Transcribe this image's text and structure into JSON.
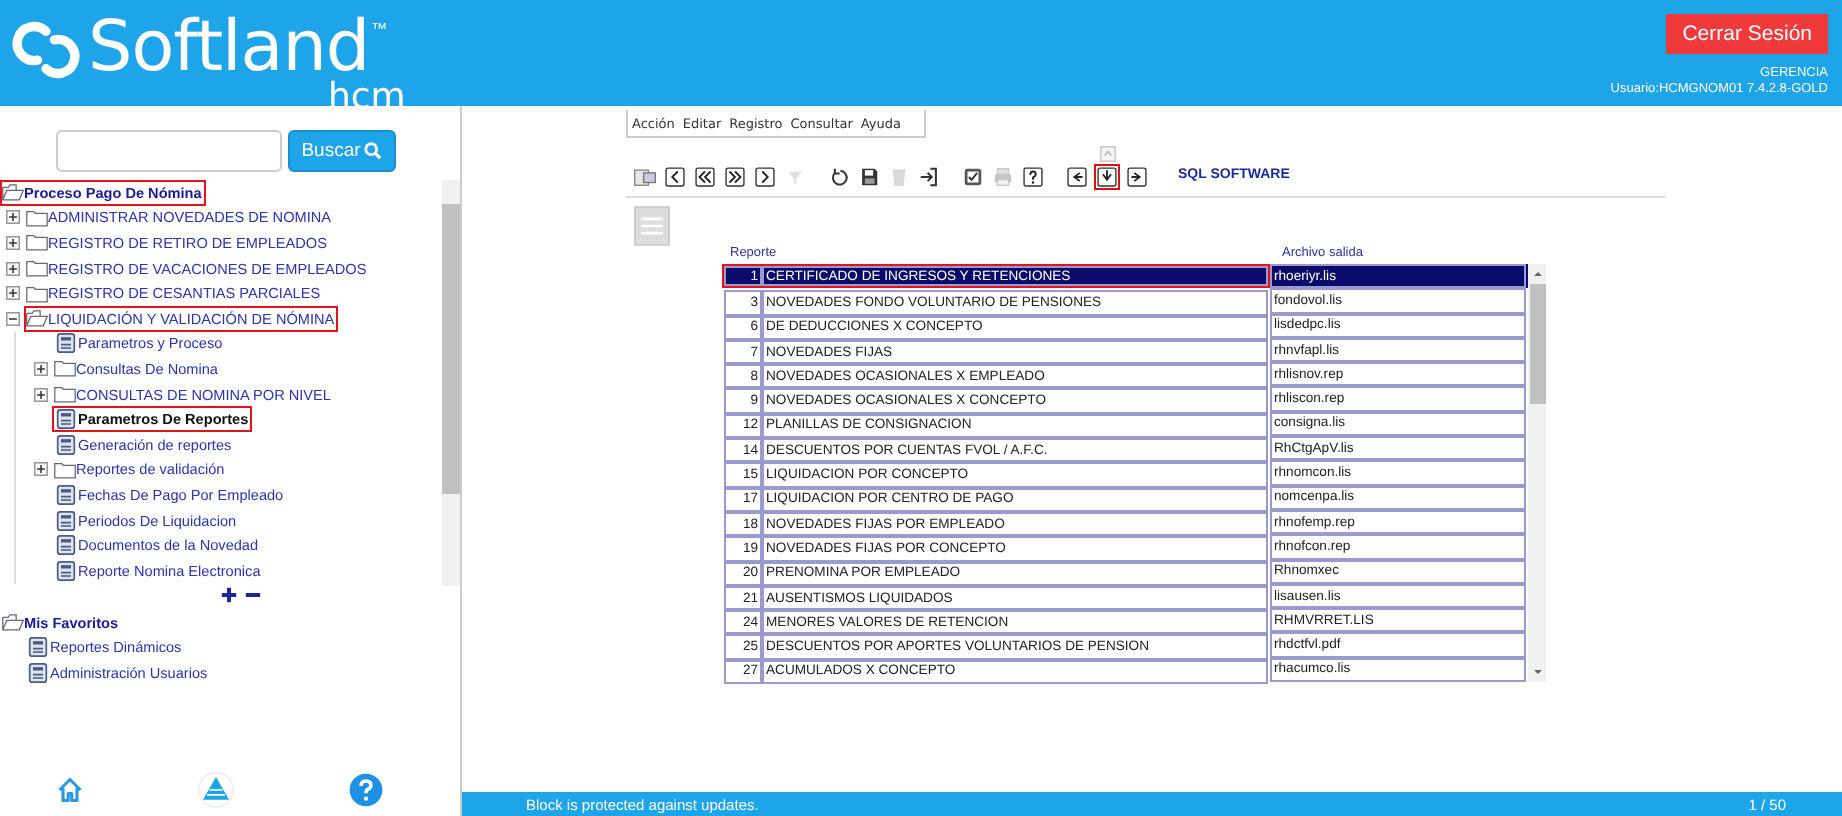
{
  "header": {
    "brand": "Softland",
    "trademark": "™",
    "product": "hcm",
    "logout_button": "Cerrar Sesión",
    "role": "GERENCIA",
    "user": "Usuario:HCMGNOM01 7.4.2.8-GOLD"
  },
  "sidebar": {
    "search_button": "Buscar",
    "tree": [
      {
        "label": "Proceso Pago De Nómina",
        "kind": "folder",
        "expanded": true,
        "highlighted": true,
        "selected": false,
        "children": [
          {
            "label": "ADMINISTRAR NOVEDADES DE NOMINA",
            "kind": "folder",
            "expanded": false,
            "highlighted": false,
            "selected": false
          },
          {
            "label": "REGISTRO DE RETIRO DE EMPLEADOS",
            "kind": "folder",
            "expanded": false,
            "highlighted": false,
            "selected": false
          },
          {
            "label": "REGISTRO DE VACACIONES DE EMPLEADOS",
            "kind": "folder",
            "expanded": false,
            "highlighted": false,
            "selected": false
          },
          {
            "label": "REGISTRO DE CESANTIAS PARCIALES",
            "kind": "folder",
            "expanded": false,
            "highlighted": false,
            "selected": false
          },
          {
            "label": "LIQUIDACIÓN Y VALIDACIÓN DE NÓMINA",
            "kind": "folder",
            "expanded": true,
            "highlighted": true,
            "selected": false,
            "children": [
              {
                "label": "Parametros y Proceso",
                "kind": "document",
                "highlighted": false,
                "selected": false
              },
              {
                "label": "Consultas De Nomina",
                "kind": "folder",
                "expanded": false,
                "highlighted": false,
                "selected": false
              },
              {
                "label": "CONSULTAS DE NOMINA POR NIVEL",
                "kind": "folder",
                "expanded": false,
                "highlighted": false,
                "selected": false
              },
              {
                "label": "Parametros De Reportes",
                "kind": "document",
                "highlighted": true,
                "selected": true
              },
              {
                "label": "Generación de reportes",
                "kind": "document",
                "highlighted": false,
                "selected": false
              },
              {
                "label": "Reportes de validación",
                "kind": "folder",
                "expanded": false,
                "highlighted": false,
                "selected": false
              },
              {
                "label": "Fechas De Pago Por Empleado",
                "kind": "document",
                "highlighted": false,
                "selected": false
              },
              {
                "label": "Periodos De Liquidacion",
                "kind": "document",
                "highlighted": false,
                "selected": false
              },
              {
                "label": "Documentos de la Novedad",
                "kind": "document",
                "highlighted": false,
                "selected": false
              },
              {
                "label": "Reporte Nomina Electronica",
                "kind": "document",
                "highlighted": false,
                "selected": false
              }
            ]
          }
        ]
      }
    ],
    "favorites": [
      {
        "label": "Mis Favoritos",
        "kind": "folder",
        "expanded": true,
        "highlighted": false,
        "selected": false,
        "children": [
          {
            "label": "Reportes Dinámicos",
            "kind": "document",
            "highlighted": false,
            "selected": false
          },
          {
            "label": "Administración Usuarios",
            "kind": "document",
            "highlighted": false,
            "selected": false
          }
        ]
      }
    ]
  },
  "form": {
    "menu": [
      "Acción",
      "Editar",
      "Registro",
      "Consultar",
      "Ayuda"
    ],
    "toolbar": [
      {
        "kind": "form",
        "disabled": false,
        "highlighted": false
      },
      {
        "kind": "previous",
        "disabled": false,
        "highlighted": false
      },
      {
        "kind": "first",
        "disabled": false,
        "highlighted": false
      },
      {
        "kind": "last",
        "disabled": false,
        "highlighted": false
      },
      {
        "kind": "next",
        "disabled": false,
        "highlighted": false
      },
      {
        "kind": "filter",
        "disabled": true,
        "highlighted": false
      },
      {
        "kind": "gap"
      },
      {
        "kind": "undo",
        "disabled": false,
        "highlighted": false
      },
      {
        "kind": "save",
        "disabled": false,
        "highlighted": false
      },
      {
        "kind": "delete",
        "disabled": true,
        "highlighted": false
      },
      {
        "kind": "exit",
        "disabled": false,
        "highlighted": false
      },
      {
        "kind": "gap"
      },
      {
        "kind": "checklist",
        "disabled": false,
        "highlighted": false
      },
      {
        "kind": "print",
        "disabled": true,
        "highlighted": false
      },
      {
        "kind": "help",
        "disabled": false,
        "highlighted": false
      },
      {
        "kind": "gap"
      },
      {
        "kind": "left",
        "disabled": false,
        "highlighted": false
      },
      {
        "kind": "down",
        "disabled": false,
        "highlighted": true
      },
      {
        "kind": "right",
        "disabled": false,
        "highlighted": false
      }
    ],
    "vendor": "SQL SOFTWARE",
    "table": {
      "columns": [
        "Reporte",
        "Archivo salida"
      ],
      "rows": [
        {
          "number": "1",
          "name": "CERTIFICADO DE INGRESOS Y RETENCIONES",
          "file": "rhoeriyr.lis",
          "selected": true,
          "highlighted": true
        },
        {
          "number": "3",
          "name": "NOVEDADES FONDO VOLUNTARIO DE PENSIONES",
          "file": "fondovol.lis",
          "selected": false,
          "highlighted": false
        },
        {
          "number": "6",
          "name": "DE DEDUCCIONES X CONCEPTO",
          "file": "lisdedpc.lis",
          "selected": false,
          "highlighted": false
        },
        {
          "number": "7",
          "name": "NOVEDADES FIJAS",
          "file": "rhnvfapl.lis",
          "selected": false,
          "highlighted": false
        },
        {
          "number": "8",
          "name": "NOVEDADES OCASIONALES X EMPLEADO",
          "file": "rhlisnov.rep",
          "selected": false,
          "highlighted": false
        },
        {
          "number": "9",
          "name": "NOVEDADES OCASIONALES X CONCEPTO",
          "file": "rhliscon.rep",
          "selected": false,
          "highlighted": false
        },
        {
          "number": "12",
          "name": "PLANILLAS DE CONSIGNACION",
          "file": "consigna.lis",
          "selected": false,
          "highlighted": false
        },
        {
          "number": "14",
          "name": "DESCUENTOS POR CUENTAS FVOL / A.F.C.",
          "file": "RhCtgApV.lis",
          "selected": false,
          "highlighted": false
        },
        {
          "number": "15",
          "name": "LIQUIDACION POR CONCEPTO",
          "file": "rhnomcon.lis",
          "selected": false,
          "highlighted": false
        },
        {
          "number": "17",
          "name": "LIQUIDACION POR CENTRO DE PAGO",
          "file": "nomcenpa.lis",
          "selected": false,
          "highlighted": false
        },
        {
          "number": "18",
          "name": "NOVEDADES FIJAS POR EMPLEADO",
          "file": "rhnofemp.rep",
          "selected": false,
          "highlighted": false
        },
        {
          "number": "19",
          "name": "NOVEDADES FIJAS POR CONCEPTO",
          "file": "rhnofcon.rep",
          "selected": false,
          "highlighted": false
        },
        {
          "number": "20",
          "name": "PRENOMINA POR EMPLEADO",
          "file": "Rhnomxec",
          "selected": false,
          "highlighted": false
        },
        {
          "number": "21",
          "name": "AUSENTISMOS LIQUIDADOS",
          "file": "lisausen.lis",
          "selected": false,
          "highlighted": false
        },
        {
          "number": "24",
          "name": "MENORES VALORES DE RETENCION",
          "file": "RHMVRRET.LIS",
          "selected": false,
          "highlighted": false
        },
        {
          "number": "25",
          "name": "DESCUENTOS POR APORTES VOLUNTARIOS DE PENSION",
          "file": "rhdctfvl.pdf",
          "selected": false,
          "highlighted": false
        },
        {
          "number": "27",
          "name": "ACUMULADOS X CONCEPTO",
          "file": "rhacumco.lis",
          "selected": false,
          "highlighted": false
        }
      ]
    }
  },
  "status_bar": {
    "message": "Block is protected against updates.",
    "record": "1 / 50"
  }
}
